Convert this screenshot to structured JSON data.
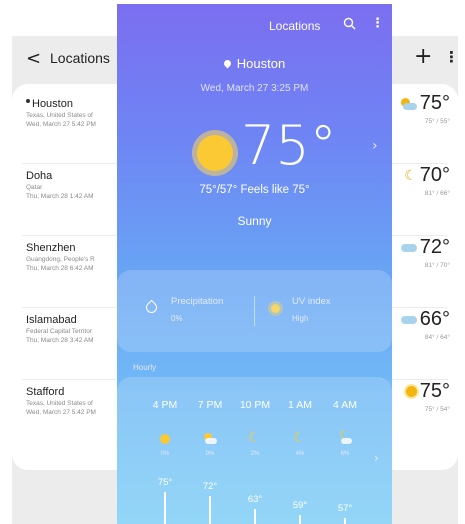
{
  "list_screen": {
    "back_icon": "chevron-left-icon",
    "title": "Locations",
    "add_icon": "plus-icon",
    "more_icon": "more-vertical-icon",
    "locations": [
      {
        "name": "Houston",
        "current": true,
        "region": "Texas, United States of",
        "datetime": "Wed, March 27 5:42 PM",
        "temp": "75°",
        "range": "75° / 55°",
        "icon": "partly-sunny-icon"
      },
      {
        "name": "Doha",
        "current": false,
        "region": "Qatar",
        "datetime": "Thu, March 28 1:42 AM",
        "temp": "70°",
        "range": "81° / 66°",
        "icon": "moon-icon"
      },
      {
        "name": "Shenzhen",
        "current": false,
        "region": "Guangdong, People's R",
        "datetime": "Thu, March 28 6:42 AM",
        "temp": "72°",
        "range": "81° / 70°",
        "icon": "cloud-icon"
      },
      {
        "name": "Islamabad",
        "current": false,
        "region": "Federal Capital Territor",
        "datetime": "Thu, March 28 3:42 AM",
        "temp": "66°",
        "range": "84° / 64°",
        "icon": "cloud-icon"
      },
      {
        "name": "Stafford",
        "current": false,
        "region": "Texas, United States of",
        "datetime": "Wed, March 27 5:42 PM",
        "temp": "75°",
        "range": "75° / 54°",
        "icon": "sun-icon"
      }
    ]
  },
  "detail": {
    "header_title": "Locations",
    "search_icon": "search-icon",
    "more_icon": "more-vertical-icon",
    "city": "Houston",
    "datetime": "Wed, March 27 3:25 PM",
    "temperature": "75°",
    "feels_line": "75°/57° Feels like 75°",
    "condition": "Sunny",
    "precipitation_label": "Precipitation",
    "precipitation_value": "0%",
    "uv_label": "UV index",
    "uv_value": "High",
    "hourly_label": "Hourly",
    "hourly": [
      {
        "time": "4 PM",
        "icon": "sun-icon",
        "precip": "0%",
        "temp": "75°",
        "temp_value": 75
      },
      {
        "time": "7 PM",
        "icon": "partly-sunny-icon",
        "precip": "0%",
        "temp": "72°",
        "temp_value": 72
      },
      {
        "time": "10 PM",
        "icon": "moon-icon",
        "precip": "2%",
        "temp": "63°",
        "temp_value": 63
      },
      {
        "time": "1 AM",
        "icon": "moon-icon",
        "precip": "4%",
        "temp": "59°",
        "temp_value": 59
      },
      {
        "time": "4 AM",
        "icon": "partly-cloudy-night-icon",
        "precip": "6%",
        "temp": "57°",
        "temp_value": 57
      }
    ]
  }
}
